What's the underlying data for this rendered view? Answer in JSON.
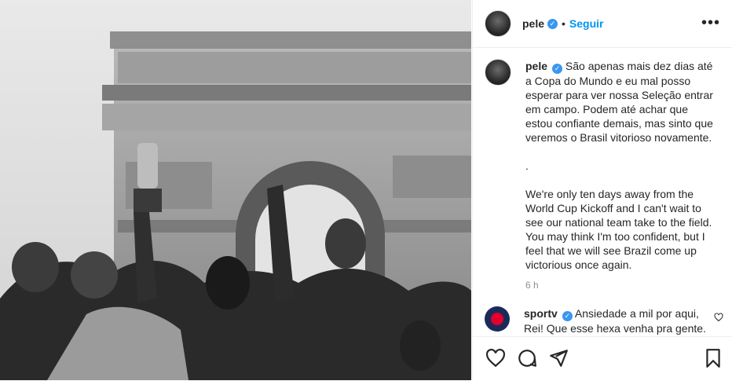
{
  "post": {
    "username": "pele",
    "follow_label": "Seguir",
    "separator": "•",
    "more_label": "•••",
    "caption_pt": "São apenas mais dez dias até a Copa do Mundo e eu mal posso esperar para ver nossa Seleção entrar em campo. Podem até achar que estou confiante demais, mas sinto que veremos o Brasil vitorioso novamente.",
    "caption_dot": ".",
    "caption_en": "We're only ten days away from the World Cup Kickoff and I can't wait to see our national team take to the field. You may think I'm too confident, but I feel that we will see Brazil come up victorious once again.",
    "time": "6 h"
  },
  "comments": [
    {
      "username": "sportv",
      "text": "Ansiedade a mil por aqui, Rei! Que esse hexa venha pra gente."
    }
  ],
  "icons": {
    "verified": "verified-badge-icon",
    "like": "heart-icon",
    "comment": "comment-icon",
    "share": "send-icon",
    "save": "bookmark-icon"
  },
  "colors": {
    "link": "#0095f6",
    "verified": "#3897f0",
    "muted": "#8e8e8e"
  }
}
